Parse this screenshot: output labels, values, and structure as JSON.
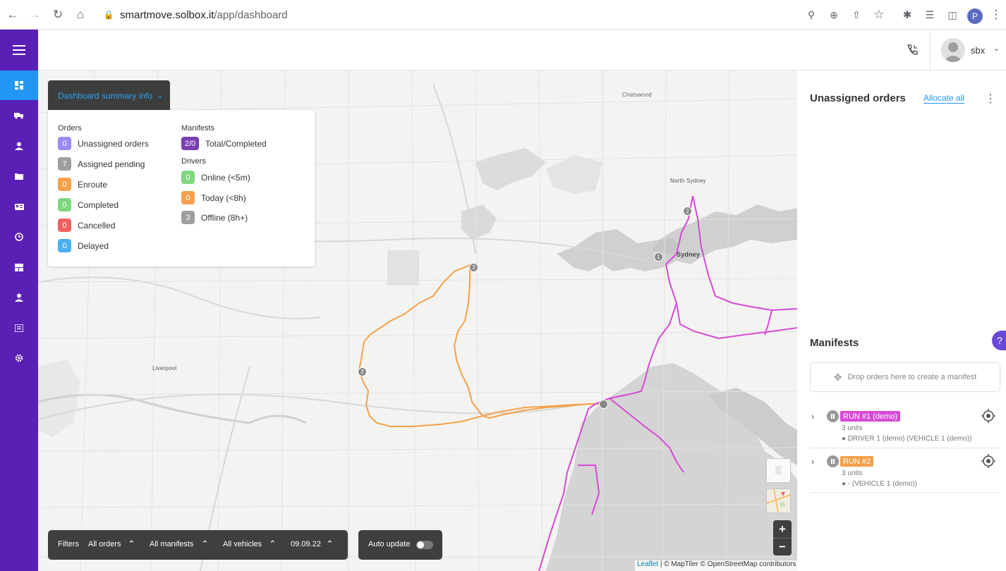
{
  "browser": {
    "url_host": "smartmove.solbox.it",
    "url_path": "/app/dashboard",
    "profile_initial": "P"
  },
  "sidebar": {
    "items": [
      {
        "icon": "dashboard-icon"
      },
      {
        "icon": "truck-icon"
      },
      {
        "icon": "person-icon"
      },
      {
        "icon": "folder-icon"
      },
      {
        "icon": "id-card-icon"
      },
      {
        "icon": "clock-icon"
      },
      {
        "icon": "grid-icon"
      },
      {
        "icon": "user-icon"
      },
      {
        "icon": "list-icon"
      },
      {
        "icon": "settings-icon"
      }
    ]
  },
  "header": {
    "user_name": "sbx"
  },
  "summary": {
    "toggle_label": "Dashboard summary info",
    "orders_heading": "Orders",
    "orders": [
      {
        "count": "0",
        "label": "Unassigned orders",
        "color": "#9b8cf5"
      },
      {
        "count": "7",
        "label": "Assigned pending",
        "color": "#9e9e9e"
      },
      {
        "count": "0",
        "label": "Enroute",
        "color": "#f5a04a"
      },
      {
        "count": "0",
        "label": "Completed",
        "color": "#7fd67f"
      },
      {
        "count": "0",
        "label": "Cancelled",
        "color": "#f0625f"
      },
      {
        "count": "0",
        "label": "Delayed",
        "color": "#4ab0f0"
      }
    ],
    "manifests_heading": "Manifests",
    "manifests": [
      {
        "count": "2/0",
        "label": "Total/Completed",
        "color": "#7a3fb0"
      }
    ],
    "drivers_heading": "Drivers",
    "drivers": [
      {
        "count": "0",
        "label": "Online (<5m)",
        "color": "#7fd67f"
      },
      {
        "count": "0",
        "label": "Today (<8h)",
        "color": "#f5a04a"
      },
      {
        "count": "3",
        "label": "Offline (8h+)",
        "color": "#9e9e9e"
      }
    ]
  },
  "filters": {
    "label": "Filters",
    "orders": "All orders",
    "manifests": "All manifests",
    "vehicles": "All vehicles",
    "date": "09.09.22",
    "auto_update": "Auto update"
  },
  "map": {
    "labels": {
      "chatswood": "Chatswood",
      "north_sydney": "North Sydney",
      "sydney": "Sydney",
      "liverpool": "Liverpool"
    },
    "markers": [
      "1",
      "2",
      "3",
      "2"
    ],
    "attribution": {
      "leaflet": "Leaflet",
      "rest": "| © MapTiler © OpenStreetMap contributors"
    },
    "zoom_in": "+",
    "zoom_out": "−",
    "route_colors": {
      "run1": "#d64ad6",
      "run2": "#f5a04a"
    }
  },
  "right_panel": {
    "unassigned_title": "Unassigned orders",
    "allocate_all": "Allocate all",
    "manifests_title": "Manifests",
    "dropzone_text": "Drop orders here to create a manifest",
    "runs": [
      {
        "name": "RUN #1 (demo)",
        "color": "#d64ad6",
        "units": "3 units",
        "driver": "DRIVER 1 (demo) (VEHICLE 1 (demo))"
      },
      {
        "name": "RUN #2",
        "color": "#f5a04a",
        "units": "3 units",
        "driver": "- (VEHICLE 1 (demo))"
      }
    ],
    "help": "?"
  }
}
